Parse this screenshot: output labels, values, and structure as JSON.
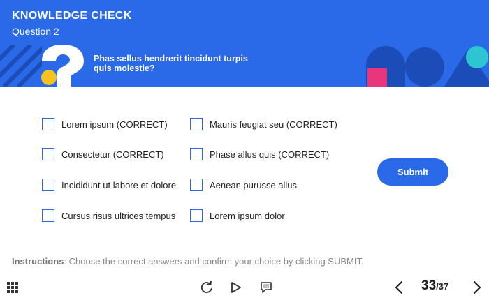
{
  "header": {
    "title": "KNOWLEDGE CHECK",
    "question_number": "Question 2",
    "question_text": "Phas sellus hendrerit tincidunt turpis quis molestie?"
  },
  "options": [
    {
      "label": "Lorem ipsum (CORRECT)",
      "checked": false
    },
    {
      "label": "Consectetur (CORRECT)",
      "checked": false
    },
    {
      "label": "Incididunt ut labore et dolore",
      "checked": false
    },
    {
      "label": "Cursus risus ultrices tempus",
      "checked": false
    },
    {
      "label": "Mauris feugiat seu (CORRECT)",
      "checked": false
    },
    {
      "label": "Phase allus quis (CORRECT)",
      "checked": false
    },
    {
      "label": "Aenean purusse allus",
      "checked": false
    },
    {
      "label": "Lorem ipsum dolor",
      "checked": false
    }
  ],
  "submit_label": "Submit",
  "instructions": {
    "label": "Instructions",
    "text": ": Choose the correct answers and confirm your choice by clicking SUBMIT."
  },
  "footer": {
    "page_current": "33",
    "page_separator": "/",
    "page_total": "37",
    "icons": [
      "grid-menu-icon",
      "replay-icon",
      "play-icon",
      "transcript-icon",
      "previous-icon",
      "next-icon"
    ]
  },
  "colors": {
    "accent_blue": "#2a6ae8",
    "deco_navy": "#1c4cb8",
    "deco_pink": "#e8367c",
    "deco_yellow": "#f7c21b",
    "deco_cyan": "#2ec5d3"
  }
}
